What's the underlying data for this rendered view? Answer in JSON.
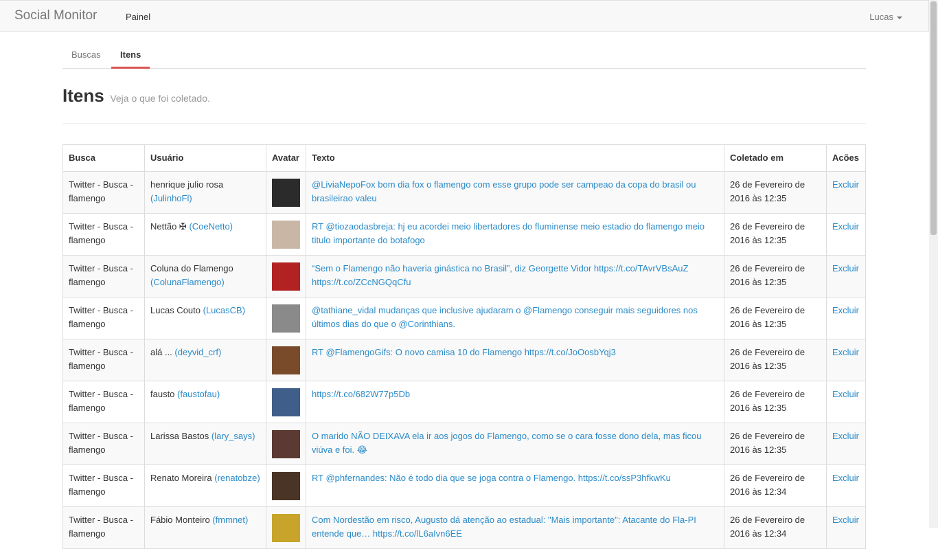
{
  "navbar": {
    "brand": "Social Monitor",
    "link": "Painel",
    "user": "Lucas"
  },
  "tabs": [
    {
      "label": "Buscas"
    },
    {
      "label": "Itens"
    }
  ],
  "header": {
    "title": "Itens",
    "subtitle": "Veja o que foi coletado."
  },
  "table": {
    "columns": [
      "Busca",
      "Usuário",
      "Avatar",
      "Texto",
      "Coletado em",
      "Acões"
    ],
    "rows": [
      {
        "busca": "Twitter - Busca - flamengo",
        "name": "henrique julio rosa",
        "handle": "(JulinhoFl)",
        "texto": "@LiviaNepoFox bom dia fox o flamengo com esse grupo pode ser campeao da copa do brasil ou brasileirao valeu",
        "coletado": "26 de Fevereiro de 2016 às 12:35",
        "acao": "Excluir",
        "avatar_color": "#2b2b2b"
      },
      {
        "busca": "Twitter - Busca - flamengo",
        "name": "Nettão ✠",
        "handle": "(CoeNetto)",
        "texto": "RT @tiozaodasbreja: hj eu acordei meio libertadores do fluminense meio estadio do flamengo meio titulo importante do botafogo",
        "coletado": "26 de Fevereiro de 2016 às 12:35",
        "acao": "Excluir",
        "avatar_color": "#c9b7a6"
      },
      {
        "busca": "Twitter - Busca - flamengo",
        "name": "Coluna do Flamengo",
        "handle": "(ColunaFlamengo)",
        "texto": "“Sem o Flamengo não haveria ginástica no Brasil”, diz Georgette Vidor https://t.co/TAvrVBsAuZ https://t.co/ZCcNGQqCfu",
        "coletado": "26 de Fevereiro de 2016 às 12:35",
        "acao": "Excluir",
        "avatar_color": "#b22222"
      },
      {
        "busca": "Twitter - Busca - flamengo",
        "name": "Lucas Couto",
        "handle": "(LucasCB)",
        "texto": "@tathiane_vidal mudanças que inclusive ajudaram o @Flamengo conseguir mais seguidores nos últimos dias do que o @Corinthians.",
        "coletado": "26 de Fevereiro de 2016 às 12:35",
        "acao": "Excluir",
        "avatar_color": "#8a8a8a"
      },
      {
        "busca": "Twitter - Busca - flamengo",
        "name": "alá ...",
        "handle": "(deyvid_crf)",
        "texto": "RT @FlamengoGifs: O novo camisa 10 do Flamengo https://t.co/JoOosbYqj3",
        "coletado": "26 de Fevereiro de 2016 às 12:35",
        "acao": "Excluir",
        "avatar_color": "#7a4b2a"
      },
      {
        "busca": "Twitter - Busca - flamengo",
        "name": "fausto",
        "handle": "(faustofau)",
        "texto": "https://t.co/682W77p5Db",
        "coletado": "26 de Fevereiro de 2016 às 12:35",
        "acao": "Excluir",
        "avatar_color": "#3f5f8a"
      },
      {
        "busca": "Twitter - Busca - flamengo",
        "name": "Larissa Bastos",
        "handle": "(lary_says)",
        "texto": "O marido NÃO DEIXAVA ela ir aos jogos do Flamengo, como se o cara fosse dono dela, mas ficou viúva e foi. 😂",
        "coletado": "26 de Fevereiro de 2016 às 12:35",
        "acao": "Excluir",
        "avatar_color": "#5a3a32"
      },
      {
        "busca": "Twitter - Busca - flamengo",
        "name": "Renato Moreira",
        "handle": "(renatobze)",
        "texto": "RT @phfernandes: Não é todo dia que se joga contra o Flamengo. https://t.co/ssP3hfkwKu",
        "coletado": "26 de Fevereiro de 2016 às 12:34",
        "acao": "Excluir",
        "avatar_color": "#4a3426"
      },
      {
        "busca": "Twitter - Busca - flamengo",
        "name": "Fábio Monteiro",
        "handle": "(fmmnet)",
        "texto": "Com Nordestão em risco, Augusto dá atenção ao estadual: \"Mais importante\": Atacante do Fla-PI entende que… https://t.co/lL6aIvn6EE",
        "coletado": "26 de Fevereiro de 2016 às 12:34",
        "acao": "Excluir",
        "avatar_color": "#c8a42a"
      }
    ]
  }
}
